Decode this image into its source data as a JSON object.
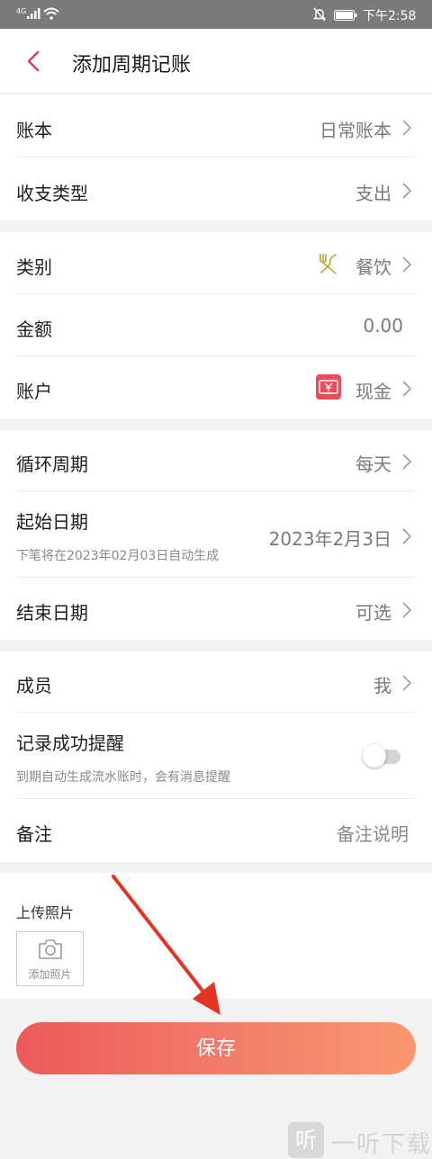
{
  "status_bar": {
    "network": "4G",
    "time": "下午2:58"
  },
  "header": {
    "title": "添加周期记账"
  },
  "section1": {
    "book": {
      "label": "账本",
      "value": "日常账本"
    },
    "type": {
      "label": "收支类型",
      "value": "支出"
    }
  },
  "section2": {
    "category": {
      "label": "类别",
      "value": "餐饮",
      "icon": "dining-icon"
    },
    "amount": {
      "label": "金额",
      "value": "0.00"
    },
    "account": {
      "label": "账户",
      "value": "现金",
      "icon": "cash-icon"
    }
  },
  "section3": {
    "cycle": {
      "label": "循环周期",
      "value": "每天"
    },
    "start": {
      "label": "起始日期",
      "value": "2023年2月3日",
      "hint": "下笔将在2023年02月03日自动生成"
    },
    "end": {
      "label": "结束日期",
      "value": "可选"
    }
  },
  "section4": {
    "member": {
      "label": "成员",
      "value": "我"
    },
    "reminder": {
      "label": "记录成功提醒",
      "hint": "到期自动生成流水账时，会有消息提醒",
      "enabled": false
    },
    "note": {
      "label": "备注",
      "placeholder": "备注说明"
    }
  },
  "upload": {
    "title": "上传照片",
    "add_label": "添加照片"
  },
  "save_button": {
    "label": "保存"
  },
  "watermark": {
    "glyph": "听",
    "text": "一听下载"
  },
  "colors": {
    "accent": "#e2405a",
    "save_gradient_start": "#ec5a5a",
    "save_gradient_end": "#fa9770",
    "annotation_arrow": "#e53322"
  }
}
